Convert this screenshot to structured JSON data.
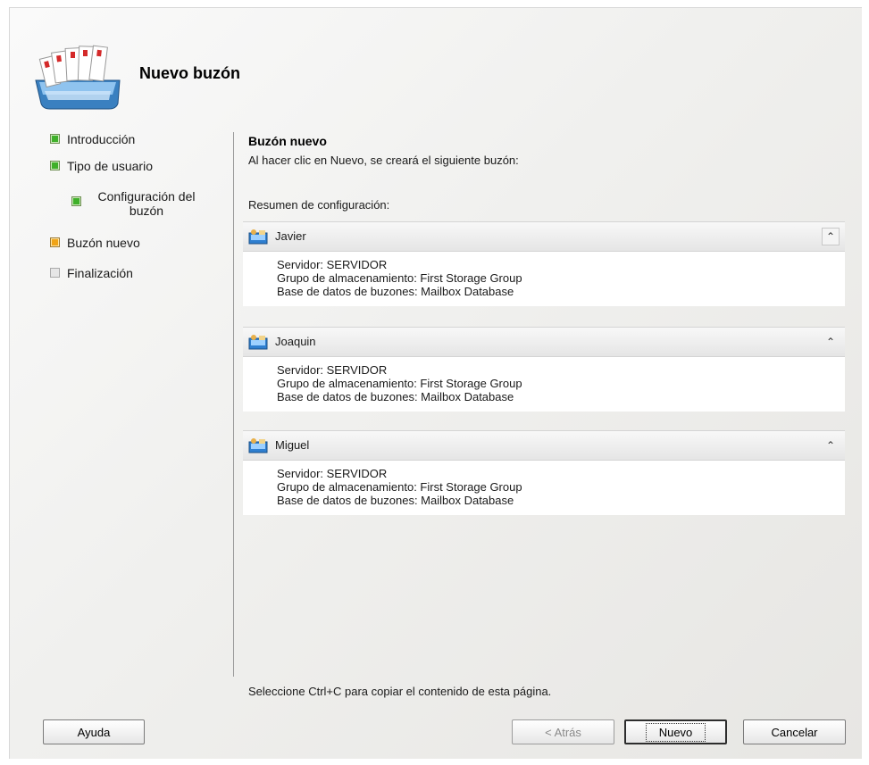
{
  "header": {
    "title": "Nuevo buzón",
    "icon": "mailbox-wizard-icon"
  },
  "nav": {
    "items": [
      {
        "label": "Introducción",
        "status": "complete",
        "color": "#3fb02a"
      },
      {
        "label": "Tipo de usuario",
        "status": "complete",
        "color": "#3fb02a"
      },
      {
        "label": "Configuración del buzón",
        "status": "complete",
        "color": "#3fb02a"
      },
      {
        "label": "Buzón nuevo",
        "status": "current",
        "color": "#f0a417"
      },
      {
        "label": "Finalización",
        "status": "pending",
        "color": "#e6e6e6"
      }
    ]
  },
  "main": {
    "section_title": "Buzón nuevo",
    "description": "Al hacer clic en Nuevo, se creará el siguiente buzón:",
    "summary_label": "Resumen de configuración:",
    "mailboxes": [
      {
        "name": "Javier",
        "server": "Servidor: SERVIDOR",
        "storage_group": "Grupo de almacenamiento: First Storage Group",
        "database": "Base de datos de buzones: Mailbox Database"
      },
      {
        "name": "Joaquin",
        "server": "Servidor: SERVIDOR",
        "storage_group": "Grupo de almacenamiento: First Storage Group",
        "database": "Base de datos de buzones: Mailbox Database"
      },
      {
        "name": "Miguel",
        "server": "Servidor: SERVIDOR",
        "storage_group": "Grupo de almacenamiento: First Storage Group",
        "database": "Base de datos de buzones: Mailbox Database"
      }
    ],
    "copy_hint": "Seleccione Ctrl+C para copiar el contenido de esta página."
  },
  "buttons": {
    "help": "Ayuda",
    "back": "< Atrás",
    "new": "Nuevo",
    "cancel": "Cancelar"
  },
  "icons": {
    "collapse": "double-chevron-up-icon",
    "user": "user-mailbox-icon"
  }
}
